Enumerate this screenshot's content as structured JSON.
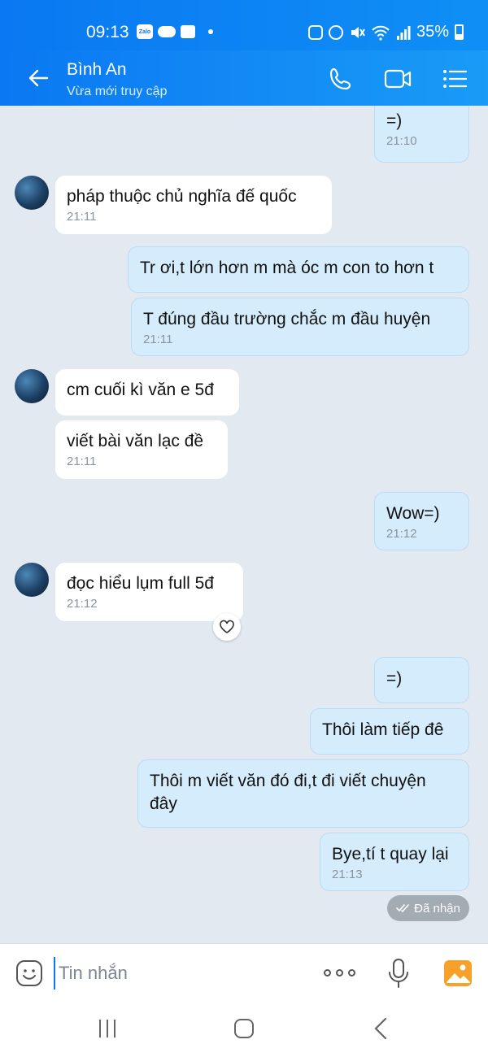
{
  "status_bar": {
    "time": "09:13",
    "battery": "35%",
    "battery_level": 0.35
  },
  "header": {
    "contact_name": "Bình An",
    "contact_status": "Vừa mới truy cập"
  },
  "messages": [
    {
      "dir": "out",
      "text": "=)",
      "time": "21:10"
    },
    {
      "dir": "in",
      "text": "pháp thuộc chủ nghĩa đế quốc",
      "time": "21:11"
    },
    {
      "dir": "out",
      "text": "Tr ơi,t lớn hơn m mà óc m con to hơn t",
      "time": ""
    },
    {
      "dir": "out",
      "text": "T đúng đầu trường chắc m đầu huyện",
      "time": "21:11"
    },
    {
      "dir": "in",
      "text": "cm cuối kì văn e 5đ",
      "time": ""
    },
    {
      "dir": "in",
      "text": "viết bài văn lạc đề",
      "time": "21:11"
    },
    {
      "dir": "out",
      "text": "Wow=)",
      "time": "21:12"
    },
    {
      "dir": "in",
      "text": "đọc hiểu lụm full 5đ",
      "time": "21:12"
    },
    {
      "dir": "out",
      "text": "=)",
      "time": ""
    },
    {
      "dir": "out",
      "text": "Thôi làm tiếp đê",
      "time": ""
    },
    {
      "dir": "out",
      "text": "Thôi m viết văn đó đi,t đi viết chuyện đây",
      "time": ""
    },
    {
      "dir": "out",
      "text": "Bye,tí t quay lại",
      "time": "21:13"
    }
  ],
  "received_label": "Đã nhận",
  "input": {
    "placeholder": "Tin nhắn"
  },
  "colors": {
    "accent": "#0a78f2",
    "outgoing_bubble": "#d5ecfc",
    "incoming_bubble": "#ffffff",
    "chat_background": "#e2e9f1"
  }
}
